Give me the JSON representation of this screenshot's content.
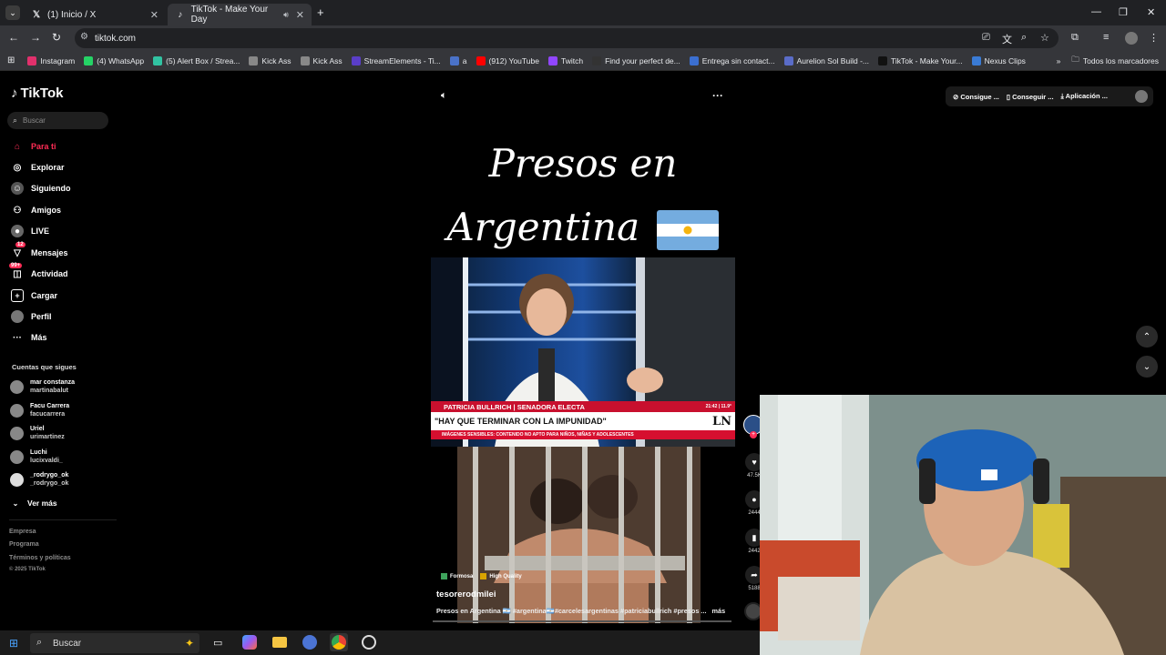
{
  "browser": {
    "tabs": [
      {
        "label": "(1) Inicio / X",
        "icon": "x-logo"
      },
      {
        "label": "TikTok - Make Your Day",
        "icon": "tiktok-logo"
      }
    ],
    "url": "tiktok.com",
    "bookmarks": [
      {
        "label": "Instagram",
        "color": "#e1306c"
      },
      {
        "label": "(4) WhatsApp",
        "color": "#25d366"
      },
      {
        "label": "(5) Alert Box / Strea...",
        "color": "#31c3a2"
      },
      {
        "label": "Kick Ass",
        "color": "#888888"
      },
      {
        "label": "Kick Ass",
        "color": "#888888"
      },
      {
        "label": "StreamElements - Ti...",
        "color": "#5a3ec8"
      },
      {
        "label": "a",
        "color": "#4a72c8"
      },
      {
        "label": "(912) YouTube",
        "color": "#ff0000"
      },
      {
        "label": "Twitch",
        "color": "#9146ff"
      },
      {
        "label": "Find your perfect de...",
        "color": "#333333"
      },
      {
        "label": "Entrega sin contact...",
        "color": "#3b6fd1"
      },
      {
        "label": "Aurelion Sol Build -...",
        "color": "#5a6cc8"
      },
      {
        "label": "TikTok - Make Your...",
        "color": "#111111"
      },
      {
        "label": "Nexus Clips",
        "color": "#3a7bd5"
      }
    ],
    "all_bookmarks": "Todos los marcadores"
  },
  "tiktok": {
    "logo": "TikTok",
    "search_placeholder": "Buscar",
    "nav": [
      {
        "label": "Para ti",
        "icon": "home-icon",
        "active": true
      },
      {
        "label": "Explorar",
        "icon": "compass-icon"
      },
      {
        "label": "Siguiendo",
        "icon": "following-icon"
      },
      {
        "label": "Amigos",
        "icon": "friends-icon"
      },
      {
        "label": "LIVE",
        "icon": "live-icon"
      },
      {
        "label": "Mensajes",
        "icon": "messages-icon",
        "badge": "12"
      },
      {
        "label": "Actividad",
        "icon": "activity-icon",
        "badge": "99+"
      },
      {
        "label": "Cargar",
        "icon": "upload-icon"
      },
      {
        "label": "Perfil",
        "icon": "profile-icon"
      },
      {
        "label": "Más",
        "icon": "more-icon"
      }
    ],
    "following_title": "Cuentas que sigues",
    "following": [
      {
        "name": "mar constanza",
        "handle": "martinabalut"
      },
      {
        "name": "Facu Carrera",
        "handle": "facucarrera"
      },
      {
        "name": "Uriel",
        "handle": "urimartinez"
      },
      {
        "name": "Luchi",
        "handle": "lucixvaldi_"
      },
      {
        "name": "_rodrygo_ok",
        "handle": "_rodrygo_ok"
      }
    ],
    "see_more": "Ver más",
    "footer": [
      "Empresa",
      "Programa",
      "Términos y políticas",
      "© 2025 TikTok"
    ],
    "top_actions": [
      "Consigue ...",
      "Conseguir ...",
      "Aplicación ..."
    ]
  },
  "video": {
    "title_line1": "Presos en",
    "title_line2": "Argentina",
    "ticker_name": "PATRICIA BULLRICH | SENADORA ELECTA",
    "ticker_time": "21:42 | 11.9°",
    "ticker_quote": "\"HAY QUE TERMINAR CON LA IMPUNIDAD\"",
    "ticker_logo": "LN",
    "ticker_warning": "IMÁGENES SENSIBLES: CONTENIDO NO APTO PARA NIÑOS, NIÑAS Y ADOLESCENTES",
    "tags": [
      "Formosa",
      "High Quality"
    ],
    "username": "tesorerodmilei",
    "description": "Presos en Argentina 🇦🇷 #argentina🇦🇷#carcelesargentinas #patriciabullrich #presos ...",
    "more": "más",
    "stats": {
      "likes": "47.5K",
      "comments": "2444",
      "saves": "2442",
      "shares": "5188"
    }
  },
  "taskbar": {
    "search_placeholder": "Buscar"
  }
}
